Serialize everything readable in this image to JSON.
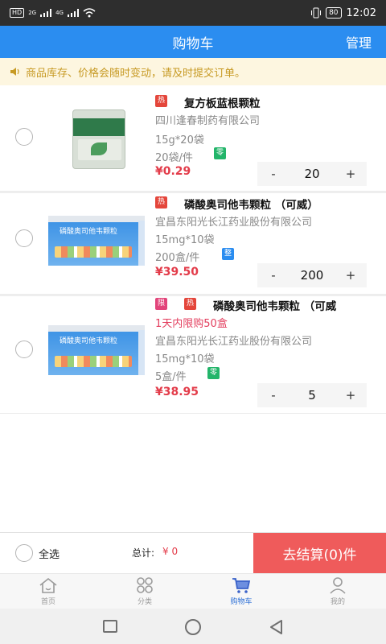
{
  "status_bar": {
    "hd": "HD",
    "net1": "2G",
    "net2": "4G",
    "battery": "80",
    "time": "12:02"
  },
  "header": {
    "title": "购物车",
    "manage": "管理"
  },
  "notice": {
    "text": "商品库存、价格会随时变动，请及时提交订单。"
  },
  "badges": {
    "hot": "热",
    "limit": "限",
    "ling": "零",
    "zheng": "整"
  },
  "items": [
    {
      "name": "复方板蓝根颗粒",
      "manufacturer": "四川逢春制药有限公司",
      "spec": "15g*20袋",
      "pack": "20袋/件",
      "price": "¥0.29",
      "qty": "20",
      "minus": "-",
      "plus": "+"
    },
    {
      "name": "磷酸奥司他韦颗粒 （可威）",
      "manufacturer": "宜昌东阳光长江药业股份有限公司",
      "spec": "15mg*10袋",
      "pack": "200盒/件",
      "price": "¥39.50",
      "qty": "200",
      "minus": "-",
      "plus": "+",
      "box_title": "磷酸奥司他韦颗粒"
    },
    {
      "name": "磷酸奥司他韦颗粒 （可威",
      "limit_text": "1天内限购50盒",
      "manufacturer": "宜昌东阳光长江药业股份有限公司",
      "spec": "15mg*10袋",
      "pack": "5盒/件",
      "price": "¥38.95",
      "qty": "5",
      "minus": "-",
      "plus": "+",
      "box_title": "磷酸奥司他韦颗粒"
    }
  ],
  "bottom_bar": {
    "select_all": "全选",
    "total_label": "总计:",
    "total_value": "¥ 0",
    "checkout": "去结算(0)件"
  },
  "tabbar": [
    {
      "label": "首页",
      "icon": "home-icon"
    },
    {
      "label": "分类",
      "icon": "category-icon"
    },
    {
      "label": "购物车",
      "icon": "cart-icon"
    },
    {
      "label": "我的",
      "icon": "profile-icon"
    }
  ],
  "colors": {
    "primary": "#2b8df0",
    "price": "#e33c4a",
    "checkout": "#ef5b5b",
    "notice_bg": "#fdf6e0"
  }
}
